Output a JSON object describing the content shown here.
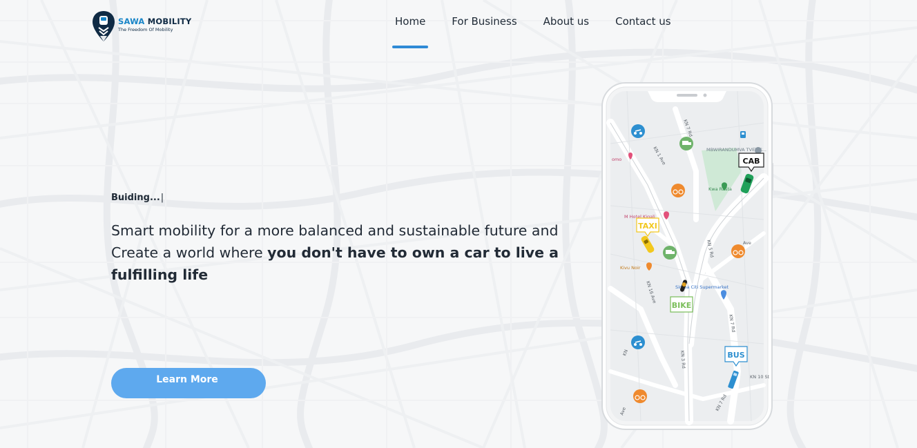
{
  "brand": {
    "name_part1": "SAWA",
    "name_part2": "MOBILITY",
    "tagline": "The Freedom Of Mobility"
  },
  "nav": {
    "items": [
      "Home",
      "For Business",
      "About us",
      "Contact us"
    ],
    "active": "Home"
  },
  "hero": {
    "typing_text": "Buiding...",
    "caret": "|",
    "headline_line1": "Smart mobility for a more balanced and sustainable future and",
    "headline_line2_plain": "Create a world where ",
    "headline_line2_bold": "you don't have to own a car to live a",
    "headline_line3_bold": "fulfilling life",
    "cta_label": "Learn More"
  },
  "phone_map": {
    "streets": [
      "KN 7 Rd",
      "KN 1 Ave",
      "KN 5 Rd",
      "KN 16 Ave",
      "KN 3 Rd",
      "KN 7 Rd",
      "KN 10 St",
      "KN 7 Rd",
      "Ave",
      "Ave",
      "KN"
    ],
    "places": [
      "MBWIRANDUMVA TVET C...",
      "Kwa Rasta",
      "M Hotel Kigali",
      "Kivu Noir",
      "Simba Citi Supermarket",
      "omo"
    ],
    "vehicle_labels": {
      "cab": "CAB",
      "taxi": "TAXI",
      "bike": "BIKE",
      "bus": "BUS"
    }
  },
  "colors": {
    "accent_blue": "#2f8ad6",
    "cta_blue": "#5ea9ee",
    "brand_blue": "#1a86c8",
    "brand_dark": "#0f2a44"
  }
}
